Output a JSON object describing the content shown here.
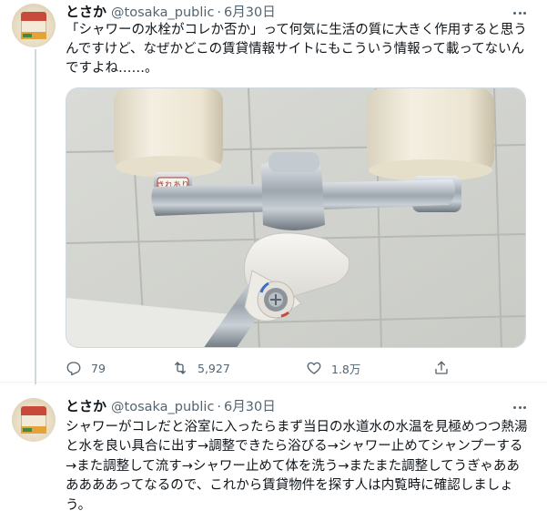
{
  "tweets": [
    {
      "display_name": "とさか",
      "handle": "@tosaka_public",
      "separator": "·",
      "date": "6月30日",
      "text": "「シャワーの水栓がコレか否か」って何気に生活の質に大きく作用すると思うんですけど、なぜかどこの賃貸情報サイトにもこういう情報って載ってないんですよね……。",
      "media": {
        "icon": "photo-two-handle-shower-faucet",
        "faucet_label": "きれあり"
      },
      "actions": {
        "reply_count": "79",
        "retweet_count": "5,927",
        "like_count": "1.8万"
      }
    },
    {
      "display_name": "とさか",
      "handle": "@tosaka_public",
      "separator": "·",
      "date": "6月30日",
      "text": "シャワーがコレだと浴室に入ったらまず当日の水道水の水温を見極めつつ熱湯と水を良い具合に出す→調整できたら浴びる→シャワー止めてシャンプーする→また調整して流す→シャワー止めて体を洗う→またまた調整してうぎゃああああああってなるので、これから賃貸物件を探す人は内覧時に確認しましょう。"
    }
  ]
}
